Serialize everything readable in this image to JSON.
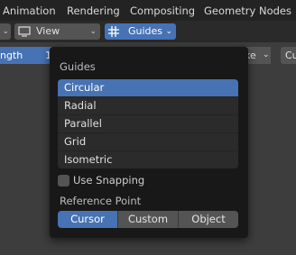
{
  "menu": {
    "tabs": [
      "Animation",
      "Rendering",
      "Compositing",
      "Geometry Nodes"
    ]
  },
  "header": {
    "view_label": "View",
    "guides_label": "Guides"
  },
  "field": {
    "length_label": "ngth",
    "partial_value": "1"
  },
  "right_fragments": {
    "a": "ke",
    "b": "Cu"
  },
  "popup": {
    "title": "Guides",
    "guides": [
      "Circular",
      "Radial",
      "Parallel",
      "Grid",
      "Isometric"
    ],
    "selected_guide": "Circular",
    "use_snapping_label": "Use Snapping",
    "use_snapping": false,
    "reference_point_label": "Reference Point",
    "reference_points": [
      "Cursor",
      "Custom",
      "Object"
    ],
    "selected_reference": "Cursor"
  },
  "colors": {
    "accent": "#4772b3",
    "popup_bg": "#181818",
    "button_bg": "#545454"
  }
}
